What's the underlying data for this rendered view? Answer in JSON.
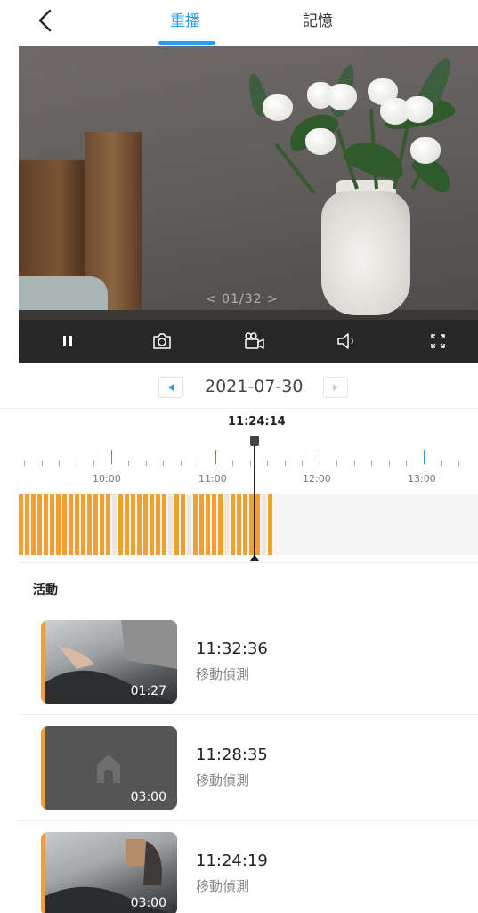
{
  "header": {
    "tabs": [
      {
        "label": "重播",
        "active": true
      },
      {
        "label": "記憶",
        "active": false
      }
    ],
    "accent_color": "#2a9df4"
  },
  "player": {
    "pager": "< 01/32 >"
  },
  "controls": {
    "icons": [
      "pause-icon",
      "camera-icon",
      "record-icon",
      "speaker-icon",
      "fullscreen-icon"
    ]
  },
  "date": {
    "value": "2021-07-30"
  },
  "timeline": {
    "current_time": "11:24:14",
    "labels": [
      "10:00",
      "11:00",
      "12:00",
      "13:00"
    ],
    "record_color": "#f0a030"
  },
  "activity": {
    "title": "活動",
    "events": [
      {
        "time": "11:32:36",
        "type": "移動偵測",
        "duration": "01:27"
      },
      {
        "time": "11:28:35",
        "type": "移動偵測",
        "duration": "03:00"
      },
      {
        "time": "11:24:19",
        "type": "移動偵測",
        "duration": "03:00"
      }
    ]
  }
}
